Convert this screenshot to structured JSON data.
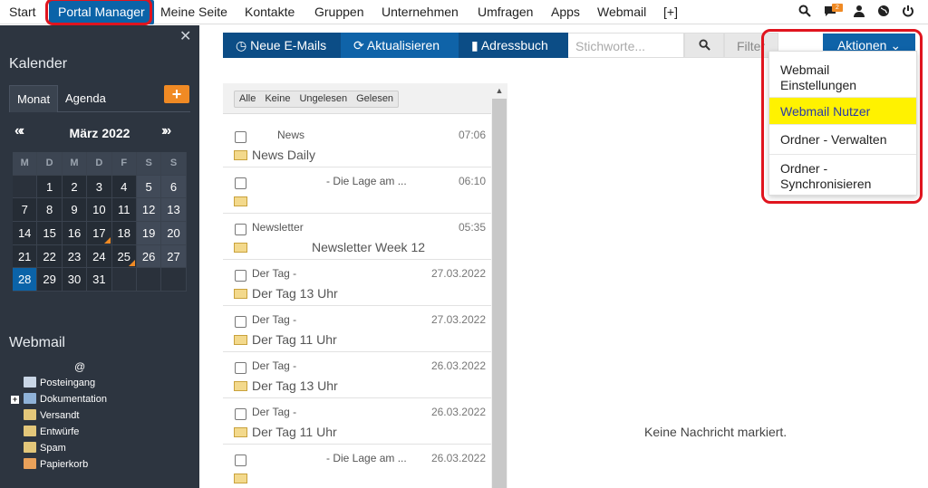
{
  "topnav": {
    "items": [
      "Start",
      "Portal Manager",
      "Meine Seite",
      "Kontakte",
      "Gruppen",
      "Unternehmen",
      "Umfragen",
      "Apps",
      "Webmail",
      "[+]"
    ],
    "active": "Portal Manager",
    "notification_count": "2"
  },
  "sidebar": {
    "calendar_title": "Kalender",
    "tabs": [
      "Monat",
      "Agenda"
    ],
    "month_label": "März 2022",
    "prev_label": "«‹",
    "next_label": "›»",
    "weekdays": [
      "M",
      "D",
      "M",
      "D",
      "F",
      "S",
      "S"
    ],
    "weeks": [
      [
        "",
        "1",
        "2",
        "3",
        "4",
        "5",
        "6"
      ],
      [
        "7",
        "8",
        "9",
        "10",
        "11",
        "12",
        "13"
      ],
      [
        "14",
        "15",
        "16",
        "17",
        "18",
        "19",
        "20"
      ],
      [
        "21",
        "22",
        "23",
        "24",
        "25",
        "26",
        "27"
      ],
      [
        "28",
        "29",
        "30",
        "31",
        "",
        "",
        ""
      ]
    ],
    "today": "28",
    "marked_days": [
      "17",
      "25"
    ],
    "webmail_title": "Webmail",
    "account_label": "@",
    "folders": [
      "Posteingang",
      "Dokumentation",
      "Versandt",
      "Entwürfe",
      "Spam",
      "Papierkorb"
    ]
  },
  "toolbar": {
    "new_mails": "Neue E-Mails",
    "refresh": "Aktualisieren",
    "addressbook": "Adressbuch",
    "search_placeholder": "Stichworte...",
    "filter": "Filter",
    "actions": "Aktionen"
  },
  "actions_menu": {
    "items": [
      "Webmail Einstellungen",
      "Webmail Nutzer",
      "Ordner - Verwalten",
      "Ordner - Synchronisieren"
    ],
    "highlighted": "Webmail Nutzer"
  },
  "mail_filters": [
    "Alle",
    "Keine",
    "Ungelesen",
    "Gelesen"
  ],
  "mails": [
    {
      "sender": "News",
      "time": "07:06",
      "subject": "News Daily"
    },
    {
      "sender": "- Die Lage am ...",
      "time": "06:10",
      "subject": ""
    },
    {
      "sender": "Newsletter",
      "time": "05:35",
      "subject": "Newsletter Week 12"
    },
    {
      "sender": "Der Tag -",
      "time": "27.03.2022",
      "subject": "Der Tag 13 Uhr"
    },
    {
      "sender": "Der Tag -",
      "time": "27.03.2022",
      "subject": "Der Tag 11 Uhr"
    },
    {
      "sender": "Der Tag -",
      "time": "26.03.2022",
      "subject": "Der Tag 13 Uhr"
    },
    {
      "sender": "Der Tag -",
      "time": "26.03.2022",
      "subject": "Der Tag 11 Uhr"
    },
    {
      "sender": "- Die Lage am ...",
      "time": "26.03.2022",
      "subject": ""
    }
  ],
  "preview": {
    "empty_text": "Keine Nachricht markiert."
  },
  "colors": {
    "accent": "#0f63a8",
    "accent_dark": "#0c4d86",
    "highlight": "#fff200",
    "sidebar": "#2d3540",
    "orange": "#f08a24",
    "annotation": "#e0141e"
  }
}
